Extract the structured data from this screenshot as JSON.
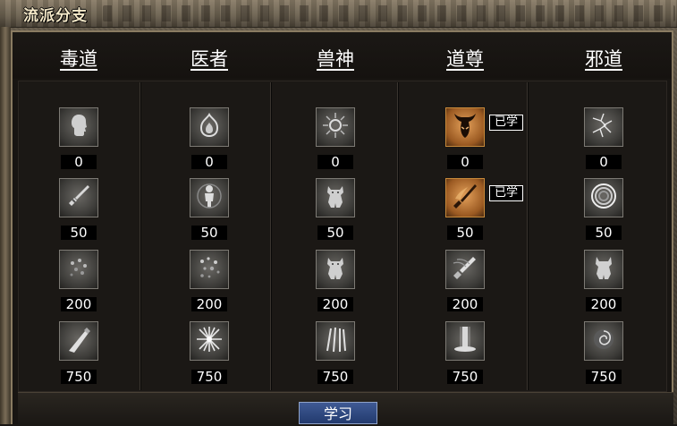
{
  "panel_title": "流派分支",
  "learned_label": "已学",
  "learn_button_label": "学习",
  "colors": {
    "frame": "#4a4236",
    "panel_bg": "#1b1815",
    "text": "#ffffff",
    "learned_icon": "#c98a3a",
    "learn_button": "#2f4a82"
  },
  "schools": [
    {
      "name": "毒道",
      "skills": [
        {
          "icon": "head-silhouette-icon",
          "cost": "0",
          "learned": false
        },
        {
          "icon": "sword-icon",
          "cost": "50",
          "learned": false
        },
        {
          "icon": "poison-cloud-icon",
          "cost": "200",
          "learned": false
        },
        {
          "icon": "blade-strike-icon",
          "cost": "750",
          "learned": false
        }
      ]
    },
    {
      "name": "医者",
      "skills": [
        {
          "icon": "flame-orb-icon",
          "cost": "0",
          "learned": false
        },
        {
          "icon": "healer-figure-icon",
          "cost": "50",
          "learned": false
        },
        {
          "icon": "spore-cloud-icon",
          "cost": "200",
          "learned": false
        },
        {
          "icon": "burst-icon",
          "cost": "750",
          "learned": false
        }
      ]
    },
    {
      "name": "兽神",
      "skills": [
        {
          "icon": "sun-rune-icon",
          "cost": "0",
          "learned": false
        },
        {
          "icon": "beast-warrior-icon",
          "cost": "50",
          "learned": false
        },
        {
          "icon": "beast-warrior-icon",
          "cost": "200",
          "learned": false
        },
        {
          "icon": "claw-slash-icon",
          "cost": "750",
          "learned": false
        }
      ]
    },
    {
      "name": "道尊",
      "skills": [
        {
          "icon": "horned-helm-icon",
          "cost": "0",
          "learned": true
        },
        {
          "icon": "flaming-sword-icon",
          "cost": "50",
          "learned": true
        },
        {
          "icon": "wind-sword-icon",
          "cost": "200",
          "learned": false
        },
        {
          "icon": "light-pillar-icon",
          "cost": "750",
          "learned": false
        }
      ]
    },
    {
      "name": "邪道",
      "skills": [
        {
          "icon": "shatter-icon",
          "cost": "0",
          "learned": false
        },
        {
          "icon": "ring-target-icon",
          "cost": "50",
          "learned": false
        },
        {
          "icon": "demon-figure-icon",
          "cost": "200",
          "learned": false
        },
        {
          "icon": "dark-rose-icon",
          "cost": "750",
          "learned": false
        }
      ]
    }
  ]
}
